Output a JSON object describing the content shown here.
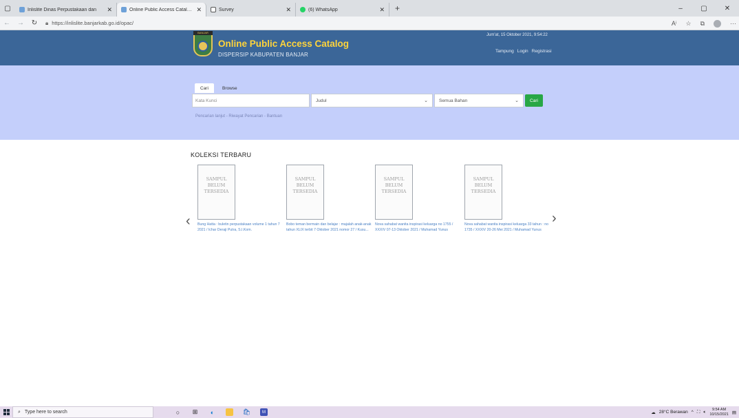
{
  "browser": {
    "tabs": [
      {
        "title": "Inlislite Dinas Perpustakaan dan",
        "icon": "library-favicon",
        "color": "#6ea1d8",
        "active": false
      },
      {
        "title": "Online Public Access Catalog - I",
        "icon": "library-favicon",
        "color": "#6ea1d8",
        "active": true
      },
      {
        "title": "Survey",
        "icon": "document-icon",
        "color": "#ffffff",
        "active": false
      },
      {
        "title": "(6) WhatsApp",
        "icon": "whatsapp-icon",
        "color": "#25d366",
        "active": false
      }
    ],
    "new_tab": "+",
    "url": "https://inlislite.banjarkab.go.id/opac/"
  },
  "site": {
    "logo_text": "BANJAR",
    "title": "Online Public Access Catalog",
    "subtitle": "DISPERSIP KABUPATEN BANJAR",
    "date": "Jum'at, 15 Oktober 2021, 9:54:22",
    "links": [
      "Tampung",
      "Login",
      "Registrasi"
    ]
  },
  "search": {
    "tabs": [
      "Cari",
      "Browse"
    ],
    "keyword_placeholder": "Kata Kunci",
    "field_select": "Judul",
    "material_select": "Semua Bahan",
    "button": "Cari",
    "links": "Pencarian lanjut - Riwayat Pencarian - Bantuan"
  },
  "collection": {
    "title": "KOLEKSI TERBARU",
    "cover_placeholder": [
      "SAMPUL",
      "BELUM",
      "TERSEDIA"
    ],
    "prev": "‹",
    "next": "›",
    "books": [
      {
        "caption": "Bung Hatta : buletin perpustakaan volume 1 tahun 7 2021 / Ichar Deraji Putra, S.I.Kom."
      },
      {
        "caption": "Bobo teman bermain dan belajar : majalah anak-anak tahun XLIX terbit 7 Oktober 2021 nomor 27 / Kusu..."
      },
      {
        "caption": "Nova sahabat wanita inspirasi keluarga no 1755 / XXXIV 07-13 Oktober 2021 / Muhamad Yunus"
      },
      {
        "caption": "Nova sahabat wanita inspirasi keluarga 33 tahun : no 1735 / XXXIV 20-26 Mei 2021 / Muhamad Yunus"
      }
    ]
  },
  "taskbar": {
    "search_placeholder": "Type here to search",
    "weather": "28°C Berawan",
    "time": "9:54 AM",
    "date": "10/15/2021"
  }
}
